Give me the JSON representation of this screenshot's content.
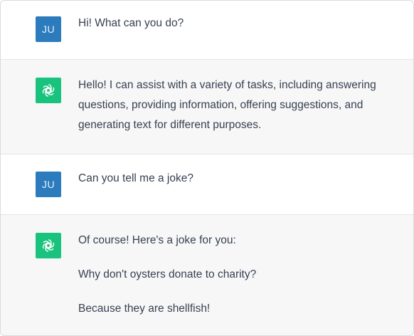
{
  "conversation": {
    "messages": [
      {
        "role": "user",
        "avatar_initials": "JU",
        "paragraphs": [
          "Hi! What can you do?"
        ]
      },
      {
        "role": "assistant",
        "avatar_icon": "openai-logo-icon",
        "paragraphs": [
          "Hello! I can assist with a variety of tasks, including answering questions, providing information, offering suggestions, and generating text for different purposes."
        ]
      },
      {
        "role": "user",
        "avatar_initials": "JU",
        "paragraphs": [
          "Can you tell me a joke?"
        ]
      },
      {
        "role": "assistant",
        "avatar_icon": "openai-logo-icon",
        "paragraphs": [
          "Of course! Here's a joke for you:",
          "Why don't oysters donate to charity?",
          "Because they are shellfish!"
        ]
      }
    ]
  },
  "colors": {
    "user_avatar_bg": "#2c7bbd",
    "assistant_avatar_bg": "#19c37d",
    "assistant_row_bg": "#f7f7f8",
    "text": "#374151"
  }
}
